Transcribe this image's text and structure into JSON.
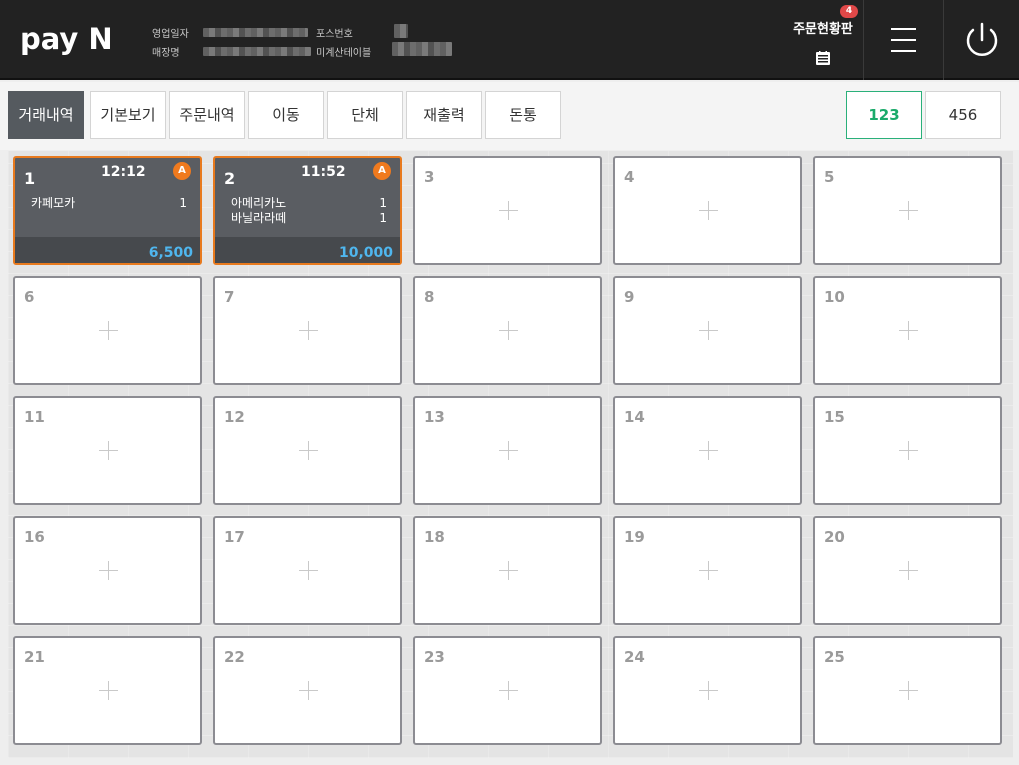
{
  "header": {
    "logo": "pay N",
    "labels": {
      "business_date": "영업일자",
      "pos_number": "포스번호",
      "store_name": "매장명",
      "unpaid_tables": "미계산테이블"
    },
    "order_board": {
      "title": "주문현황판",
      "badge": "4"
    }
  },
  "toolbar": {
    "buttons": [
      "거래내역",
      "기본보기",
      "주문내역",
      "이동",
      "단체",
      "재출력",
      "돈통"
    ],
    "pages": [
      "123",
      "456"
    ]
  },
  "tables": [
    {
      "num": "1",
      "time": "12:12",
      "badge": "A",
      "items": [
        {
          "name": "카페모카",
          "qty": "1"
        }
      ],
      "total": "6,500"
    },
    {
      "num": "2",
      "time": "11:52",
      "badge": "A",
      "items": [
        {
          "name": "아메리카노",
          "qty": "1"
        },
        {
          "name": "바닐라라떼",
          "qty": "1"
        }
      ],
      "total": "10,000"
    },
    {
      "num": "3"
    },
    {
      "num": "4"
    },
    {
      "num": "5"
    },
    {
      "num": "6"
    },
    {
      "num": "7"
    },
    {
      "num": "8"
    },
    {
      "num": "9"
    },
    {
      "num": "10"
    },
    {
      "num": "11"
    },
    {
      "num": "12"
    },
    {
      "num": "13"
    },
    {
      "num": "14"
    },
    {
      "num": "15"
    },
    {
      "num": "16"
    },
    {
      "num": "17"
    },
    {
      "num": "18"
    },
    {
      "num": "19"
    },
    {
      "num": "20"
    },
    {
      "num": "21"
    },
    {
      "num": "22"
    },
    {
      "num": "23"
    },
    {
      "num": "24"
    },
    {
      "num": "25"
    }
  ],
  "colors": {
    "accent_orange": "#e87a1e",
    "total_blue": "#4fb6ee",
    "page_green": "#1aaa6a",
    "badge_red": "#e04848"
  }
}
